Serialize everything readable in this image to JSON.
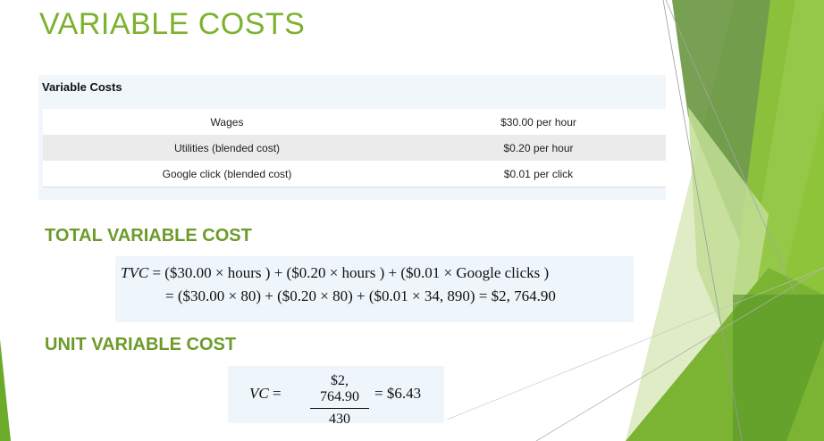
{
  "title": "VARIABLE COSTS",
  "cost_table": {
    "caption": "Variable Costs",
    "rows": [
      {
        "item": "Wages",
        "cost": "$30.00 per hour"
      },
      {
        "item": "Utilities (blended cost)",
        "cost": "$0.20 per hour"
      },
      {
        "item": "Google click (blended cost)",
        "cost": "$0.01 per click"
      }
    ]
  },
  "total_variable_cost": {
    "heading": "TOTAL VARIABLE COST",
    "formula_var": "TVC",
    "line1": " = ($30.00 × hours ) + ($0.20 × hours ) + ($0.01 × Google clicks )",
    "line2": "= ($30.00 × 80) + ($0.20 × 80) + ($0.01 × 34, 890) = $2, 764.90"
  },
  "unit_variable_cost": {
    "heading": "UNIT VARIABLE COST",
    "formula_var": "VC",
    "equals": " =",
    "numerator": "$2, 764.90",
    "denominator": "430",
    "result": "= $6.43"
  },
  "colors": {
    "title_green": "#7cb22e",
    "heading_green": "#6d9b2a",
    "box_bg": "#eef5fb"
  }
}
